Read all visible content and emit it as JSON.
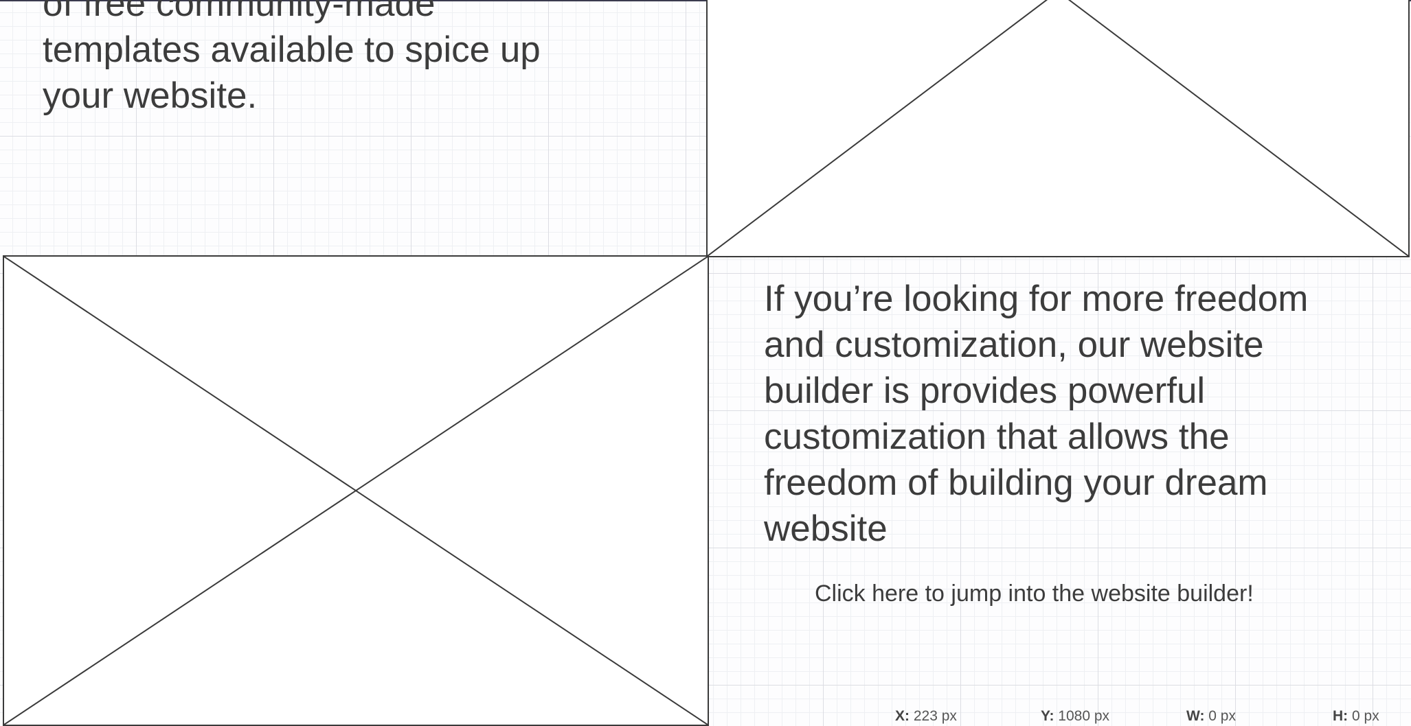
{
  "canvas": {
    "top_paragraph_lines": "of free community-made\ntemplates available to spice up\nyour website.",
    "right_paragraph": "If you’re looking for more freedom\nand customization, our website\nbuilder is provides powerful\ncustomization that allows the\nfreedom of building your dream\nwebsite",
    "cta_link": "Click here to jump into the website builder!"
  },
  "image_placeholders": [
    {
      "label": "image-placeholder-top-right",
      "icon": "cross-placeholder"
    },
    {
      "label": "image-placeholder-bottom-left",
      "icon": "cross-placeholder"
    }
  ],
  "status_bar": {
    "x_label": "X:",
    "x_value": "223 px",
    "y_label": "Y:",
    "y_value": "1080 px",
    "w_label": "W:",
    "w_value": "0 px",
    "h_label": "H:",
    "h_value": "0 px"
  },
  "colors": {
    "text": "#3c3c3c",
    "grid_major": "#dcdde3",
    "grid_minor": "#eef0f3",
    "wire_stroke": "#3a3a3a"
  }
}
